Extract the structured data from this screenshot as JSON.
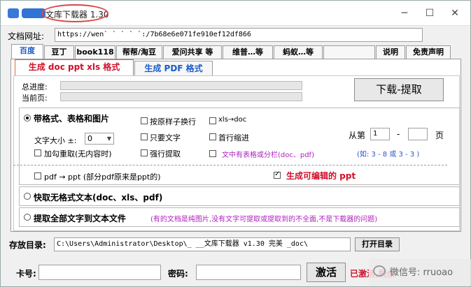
{
  "window": {
    "title": "文库下载器 1.30",
    "controls": {
      "minimize": "─",
      "maximize": "☐",
      "close": "✕"
    }
  },
  "url_row": {
    "label": "文档网址:",
    "value": "https://wen`          `    `       `      `:/7b68e6e071fe910ef12df866"
  },
  "site_tabs": [
    {
      "label": "百度",
      "active": true
    },
    {
      "label": "豆丁"
    },
    {
      "label": "book118"
    },
    {
      "label": "帮帮/淘豆"
    },
    {
      "label": "爱问共享 等"
    },
    {
      "label": "维普…等"
    },
    {
      "label": "蚂蚁…等"
    },
    {
      "label": ""
    },
    {
      "label": "说明"
    },
    {
      "label": "免责声明"
    }
  ],
  "format_tabs": [
    {
      "label": "生成 doc ppt xls 格式",
      "active": true
    },
    {
      "label": "生成 PDF 格式"
    }
  ],
  "progress": {
    "total_label": "总进度:",
    "current_label": "当前页:",
    "total_value": 0,
    "current_value": 0
  },
  "download_button": "下载-提取",
  "format_group": {
    "title": "带格式、表格和图片",
    "font_size_label": "文字大小 ±:",
    "font_size_value": "0",
    "options": {
      "reload": "加勾重取(无内容时)",
      "wrap": "按原样子换行",
      "text_only": "只要文字",
      "force": "强行提取",
      "xls_doc": "xls→doc",
      "indent": "首行缩进",
      "table_columns": "文中有表格或分栏(doc、pdf)"
    },
    "page_from_label": "从第",
    "page_from_value": "1",
    "page_dash": "-",
    "page_to_value": "",
    "page_suffix": "页",
    "page_example": "(如: 3 - 8  或 3 - 3 )",
    "pdf_ppt": "pdf → ppt (部分pdf原来是ppt的)",
    "editable_ppt": "生成可编辑的 ppt"
  },
  "fast_text": "快取无格式文本(doc、xls、pdf)",
  "extract_all": {
    "label": "提取全部文字到文本文件",
    "note": "(有的文档是纯图片,没有文字可提取或提取到的不全面,不是下载器的问题)"
  },
  "save_row": {
    "label": "存放目录:",
    "path": "C:\\Users\\Administrator\\Desktop\\_  __文库下载器 v1.30 完美          _doc\\",
    "open_button": "打开目录"
  },
  "activation": {
    "card_label": "卡号:",
    "card_value": "",
    "password_label": "密码:",
    "password_value": "",
    "activate_button": "激活",
    "status": "已激活,剩余"
  },
  "watermark": "微信号: rruoao",
  "colors": {
    "accent_red": "#d0102a",
    "note_purple": "#b01ec0",
    "tab_blue": "#1a5cc8",
    "progress_green": "#06b025"
  }
}
